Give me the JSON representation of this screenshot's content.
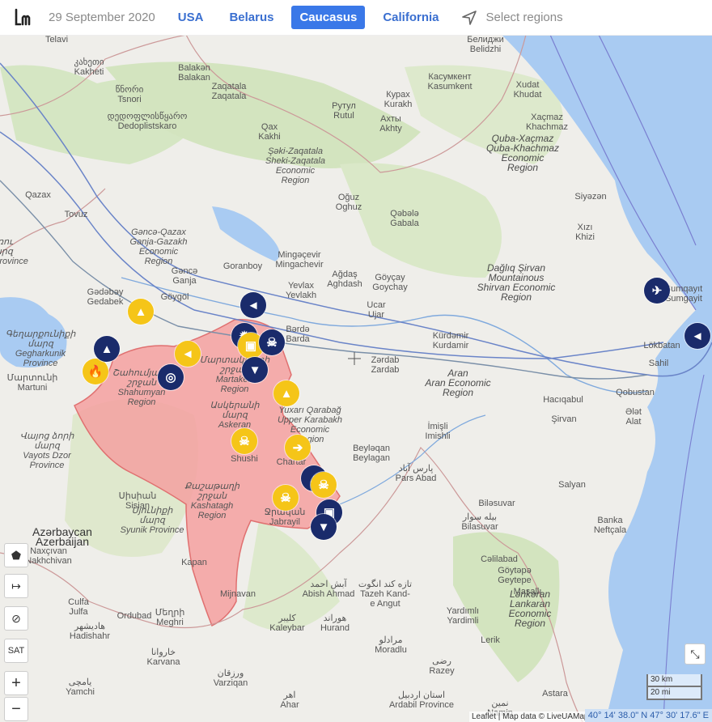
{
  "header": {
    "logo_icon": "livemap-logo-icon",
    "date": "29 September 2020",
    "tabs": [
      {
        "label": "USA",
        "active": false
      },
      {
        "label": "Belarus",
        "active": false
      },
      {
        "label": "Caucasus",
        "active": true
      },
      {
        "label": "California",
        "active": false
      }
    ],
    "select_regions_icon": "navigation-arrow-icon",
    "select_regions": "Select regions"
  },
  "colors": {
    "accent": "#3a78e8",
    "event_yellow": "#f5c518",
    "event_navy": "#1a2b6b",
    "occupied_fill": "#f4a0a0",
    "water": "#a9cbf2"
  },
  "map": {
    "labels": {
      "telavi": "Telavi",
      "kakheti": "კახეთი\nKakheti",
      "tsnori": "წნორი\nTsnori",
      "dedoplistskaro": "დედოფლისწყარო\nDedoplistskaro",
      "balakan": "Balakən\nBalakan",
      "zaqatala": "Zaqatala\nZaqatala",
      "qax": "Qax\nKakhi",
      "sheki_region": "Şəki-Zaqatala\nSheki-Zaqatala\nEconomic\nRegion",
      "rutul": "Рутул\nRutul",
      "kurakh": "Курах\nKurakh",
      "akhty": "Ахты\nAkhty",
      "kasumkent": "Касумкент\nKasumkent",
      "belidzhi": "Белиджи\nBelidzhi",
      "khudat": "Xudat\nKhudat",
      "khachmaz": "Xaçmaz\nKhachmaz",
      "quba_region": "Quba-Xaçmaz\nQuba-Khachmaz\nEconomic\nRegion",
      "siyazan": "Siyəzən",
      "khizi": "Xızı\nKhizi",
      "qazax": "Qazax",
      "tovuz": "Tovuz",
      "ganja_region": "Gəncə-Qazax\nGanja-Gazakh\nEconomic\nRegion",
      "oguz": "Oğuz\nOghuz",
      "qabala": "Qəbələ\nGabala",
      "mingachevir": "Mingəçevir\nMingachevir",
      "ganja": "Gəncə\nGanja",
      "goranboy": "Goranboy",
      "yevlax": "Yevlax\nYevlakh",
      "agdash": "Ağdaş\nAghdash",
      "goychay": "Göyçay\nGoychay",
      "shirvan_region": "Dağlıq Şirvan\nMountainous\nShirvan Economic\nRegion",
      "sumgait": "Sumqayıt\nSumgayit",
      "gadabay": "Gədəbəy\nGedabek",
      "goygol": "Göygöl",
      "ucar": "Ucar\nUjar",
      "barda": "Bərdə\nBarda",
      "gegharkunik": "Գեղարքունիքի\nմարզ\nGegharkunik\nProvince",
      "martuni": "Մարտունի\nMartuni",
      "shahumyan": "Շահումյանի\nշրջան\nShahumyan\nRegion",
      "martakert": "Մարտակերտի\nշրջան\nMartakert\nRegion",
      "askeran": "Ասկերանի\nմարզ\nAskeran",
      "kurdamir": "Kürdəmir\nKurdamir",
      "zardab": "Zərdab\nZardab",
      "lokbatan": "Lökbatan",
      "sahil": "Sahil",
      "aran_region": "Aran\nAran Economic\nRegion",
      "haciqabul": "Hacıqabul",
      "shirvan": "Şirvan",
      "qobustan": "Qobustan",
      "alat": "Ələt\nAlat",
      "upper_karabakh": "Yuxarı Qarabağ\nUpper Karabakh\nEconomic\nRegion",
      "imishli": "İmişli\nImishli",
      "beylagan": "Beyləqan\nBeylagan",
      "shushi": "Shushi",
      "charten": "Chartar",
      "vayots": "Վայոց ձորի\nմարզ\nVayots Dzor\nProvince",
      "pars_abad": "پارس آباد\nPars Abad",
      "salyan": "Salyan",
      "sisian": "Սիսիան\nSisian",
      "syunik": "Սյունիքի\nմարզ\nSyunik Province",
      "kashatagh": "Քաշաթաղի\nշրջան\nKashatagh\nRegion",
      "jabrayil": "Ջրական\nJabrayil",
      "bilasuvar": "بیله سوار\nBilasuvar",
      "bilasuvar2": "Biləsuvar",
      "banka": "Banka\nNeftçala",
      "azerbaijan": "Azərbaycan\nAzerbaijan",
      "nakhchivan": "Naxçıvan\nNakhchivan",
      "kapan": "Kapan",
      "calilabad": "Cəlilabad",
      "geytepe": "Göytəpə\nGeytepe",
      "masalli": "Masallı",
      "lankaran_region": "Lənkəran\nLankaran\nEconomic\nRegion",
      "mijnavan": "Mijnavan",
      "abish_ahmad": "آبش احمد\nAbish Ahmad",
      "tazeh_kand": "تازه کند انگوت\nTazeh Kand-\ne Angut",
      "yardimli": "Yardımlı\nYardimli",
      "lerik": "Lerik",
      "julfa": "Culfa\nJulfa",
      "hadishahr": "هادیشهر\nHadishahr",
      "ordubad": "Ordubad",
      "meghri": "Մեղրի\nMeghri",
      "kaleybar": "کلیبر\nKaleybar",
      "hurand": "هوراند\nHurand",
      "moradlu": "مرادلو\nMoradlu",
      "karvana": "خاروانا\nKarvana",
      "razey": "رضی\nRazey",
      "yamchi": "یامچی\nYamchi",
      "varziqan": "ورزقان\nVarziqan",
      "ahar": "اهر\nAhar",
      "ardabil": "استان اردبیل\nArdabil Province",
      "astara": "Astara",
      "namin": "نمین\nNamin",
      "lusht_province": "Լոռու\nմարզ\nLush Province"
    },
    "markers": [
      {
        "icon": "tank-icon",
        "glyph": "▲",
        "color": "yellow"
      },
      {
        "icon": "fire-icon",
        "glyph": "🔥",
        "color": "yellow"
      },
      {
        "icon": "missile-icon",
        "glyph": "▲",
        "color": "navy"
      },
      {
        "icon": "satellite-icon",
        "glyph": "◎",
        "color": "navy"
      },
      {
        "icon": "megaphone-icon",
        "glyph": "◄",
        "color": "yellow"
      },
      {
        "icon": "megaphone-icon",
        "glyph": "◄",
        "color": "navy"
      },
      {
        "icon": "explosion-icon",
        "glyph": "✹",
        "color": "navy"
      },
      {
        "icon": "camera-icon",
        "glyph": "▣",
        "color": "yellow"
      },
      {
        "icon": "skull-icon",
        "glyph": "☠",
        "color": "navy"
      },
      {
        "icon": "bomb-icon",
        "glyph": "▼",
        "color": "navy"
      },
      {
        "icon": "missile-icon",
        "glyph": "▲",
        "color": "yellow"
      },
      {
        "icon": "skull-icon",
        "glyph": "☠",
        "color": "yellow"
      },
      {
        "icon": "arrow-icon",
        "glyph": "➔",
        "color": "yellow"
      },
      {
        "icon": "missile-icon",
        "glyph": "▲",
        "color": "navy"
      },
      {
        "icon": "skull-icon",
        "glyph": "☠",
        "color": "yellow"
      },
      {
        "icon": "skull-icon",
        "glyph": "☠",
        "color": "yellow"
      },
      {
        "icon": "tank-icon",
        "glyph": "▣",
        "color": "navy"
      },
      {
        "icon": "bomb-icon",
        "glyph": "▼",
        "color": "navy"
      },
      {
        "icon": "airplane-icon",
        "glyph": "✈",
        "color": "navy"
      },
      {
        "icon": "megaphone-icon",
        "glyph": "◄",
        "color": "navy"
      }
    ],
    "controls": {
      "polygon": "⬟",
      "measure": "↦",
      "hide": "⊘",
      "sat": "SAT",
      "zoom_in": "+",
      "zoom_out": "−",
      "fullscreen": "⤡"
    },
    "scale": {
      "km": "30 km",
      "mi": "20 mi"
    },
    "coordinates": "40° 14' 38.0\" N 47° 30' 17.6\" E",
    "attribution": "Leaflet | Map data © LiveUAMap OpenStreetMap contributors"
  }
}
